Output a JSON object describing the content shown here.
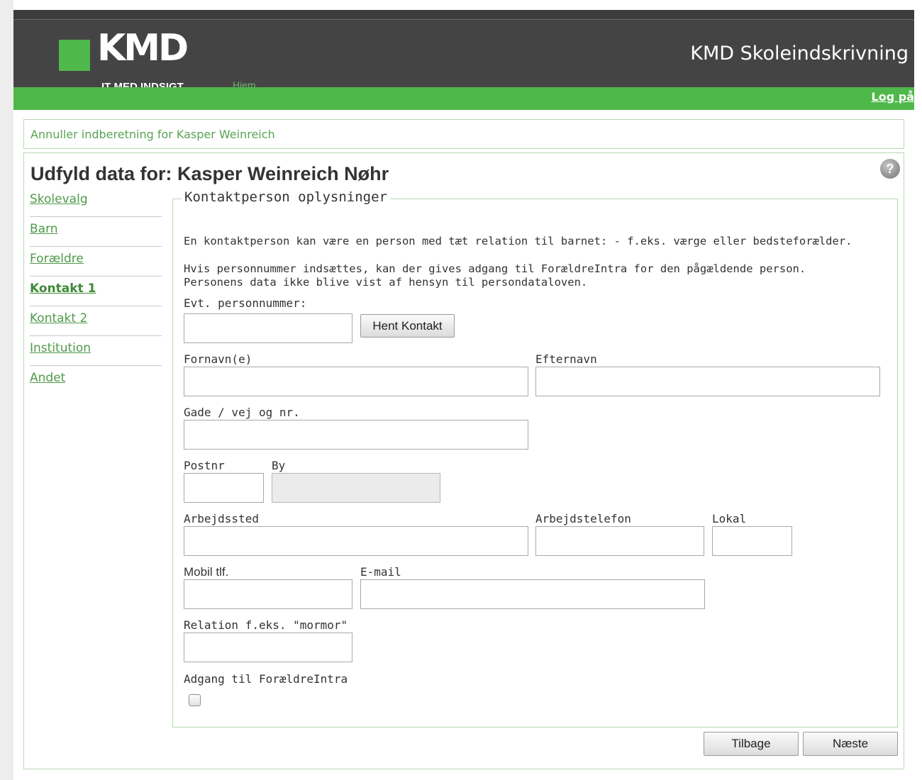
{
  "header": {
    "logo_text": "KMD",
    "tagline": "IT MED INDSIGT",
    "home_link": "Hjem",
    "app_title": "KMD Skoleindskrivning",
    "login_link": "Log på"
  },
  "cancel_link": "Annuller indberetning for Kasper Weinreich",
  "page_title": "Udfyld data for: Kasper Weinreich Nøhr",
  "nav": {
    "items": [
      {
        "label": "Skolevalg"
      },
      {
        "label": "Barn"
      },
      {
        "label": "Forældre"
      },
      {
        "label": "Kontakt 1"
      },
      {
        "label": "Kontakt 2"
      },
      {
        "label": "Institution"
      },
      {
        "label": "Andet"
      }
    ],
    "active": "Kontakt 1"
  },
  "form": {
    "legend": "Kontaktperson oplysninger",
    "info1": "En kontaktperson kan være en person med tæt relation til barnet: - f.eks. værge eller bedsteforælder.",
    "info2": "Hvis personnummer indsættes, kan der gives adgang til ForældreIntra for den pågældende person.",
    "info3": "Personens data ikke blive vist af hensyn til persondataloven.",
    "cpr_label": "Evt. personnummer:",
    "cpr_value": "",
    "fetch_button": "Hent Kontakt",
    "firstname_label": "Fornavn(e)",
    "firstname_value": "",
    "lastname_label": "Efternavn",
    "lastname_value": "",
    "street_label": "Gade / vej og nr.",
    "street_value": "",
    "zip_label": "Postnr",
    "zip_value": "",
    "city_label": "By",
    "city_value": "",
    "workplace_label": "Arbejdssted",
    "workplace_value": "",
    "workphone_label": "Arbejdstelefon",
    "workphone_value": "",
    "ext_label": "Lokal",
    "ext_value": "",
    "mobile_label": "Mobil tlf.",
    "mobile_value": "",
    "email_label": "E-mail",
    "email_value": "",
    "relation_label": "Relation f.eks. \"mormor\"",
    "relation_value": "",
    "access_label": "Adgang til ForældreIntra",
    "access_checked": false
  },
  "buttons": {
    "back": "Tilbage",
    "next": "Næste"
  },
  "colors": {
    "brand_green": "#4fb84a",
    "header_dark": "#444444",
    "link_green": "#4f9a49"
  }
}
